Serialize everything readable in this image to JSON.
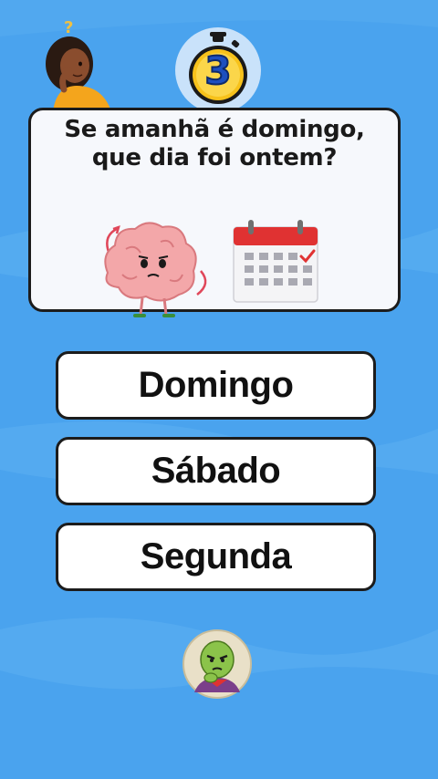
{
  "question": {
    "line1": "Se amanhã é domingo,",
    "line2": "que dia foi ontem?"
  },
  "timer": {
    "value": "3"
  },
  "answers": [
    {
      "label": "Domingo"
    },
    {
      "label": "Sábado"
    },
    {
      "label": "Segunda"
    }
  ],
  "colors": {
    "background": "#4aa3ee",
    "card": "#f6f8fc",
    "answer_bg": "#ffffff",
    "timer_yellow": "#f7c21b",
    "timer_blue": "#1d4fbf",
    "calendar_red": "#e03232",
    "brain_pink": "#f3a7a9"
  },
  "icons": {
    "thinker": "thinking-woman-icon",
    "timer": "stopwatch-icon",
    "brain": "brain-character-icon",
    "calendar": "calendar-icon",
    "avatar": "alien-avatar-icon"
  }
}
